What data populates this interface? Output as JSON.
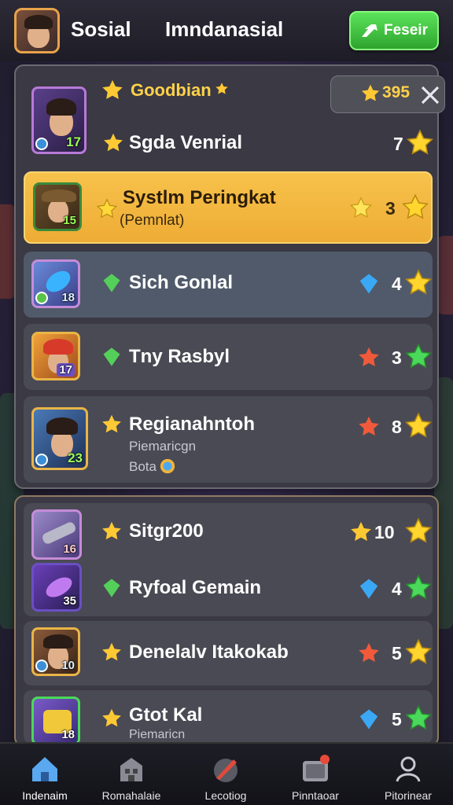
{
  "topbar": {
    "tab_social": "Sosial",
    "tab_individual": "Imndanasial",
    "refresh_label": "Feseir"
  },
  "panel1": {
    "title": "Goodbian",
    "score": "395",
    "rows": [
      {
        "name": "Sgda Venrial",
        "rank": "7",
        "level": "17"
      },
      {
        "name": "Systlm Peringkat",
        "sub": "(Pemnlat)",
        "rank": "3",
        "level": "15"
      },
      {
        "name": "Sich Gonlal",
        "rank": "4",
        "level": "18"
      },
      {
        "name": "Tny Rasbyl",
        "rank": "3",
        "level": "17"
      },
      {
        "name": "Regianahntoh",
        "sub": "Piemaricgn",
        "sub2": "Bota",
        "rank": "8",
        "level": "23"
      }
    ]
  },
  "panel2": {
    "rows": [
      {
        "name": "Sitgr200",
        "rank": "10",
        "level": "16"
      },
      {
        "name": "Ryfoal Gemain",
        "rank": "4",
        "level": "35"
      },
      {
        "name": "Denelalv Itakokab",
        "rank": "5",
        "level": "10"
      },
      {
        "name": "Gtot Kal",
        "sub": "Piemaricn",
        "rank": "5",
        "level": "18"
      }
    ]
  },
  "nav": [
    {
      "label": "Indenaim"
    },
    {
      "label": "Romahalaie"
    },
    {
      "label": "Lecotiog"
    },
    {
      "label": "Pinntaoar"
    },
    {
      "label": "Pitorinear"
    }
  ],
  "colors": {
    "gold": "#ffd24a",
    "green_button": "#3cc43a",
    "highlight_row": "#f2b53e"
  }
}
